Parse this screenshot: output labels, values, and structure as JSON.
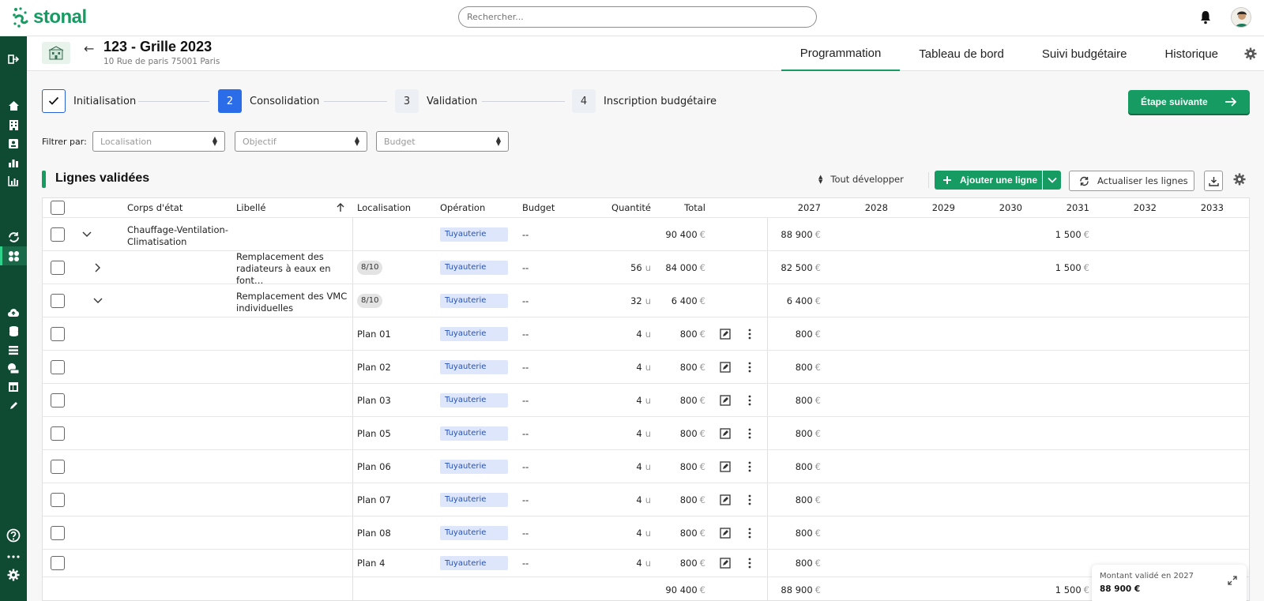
{
  "brand": {
    "name": "stonal",
    "color": "#169b62"
  },
  "search": {
    "placeholder": "Rechercher..."
  },
  "header": {
    "title": "123 - Grille 2023",
    "address": "10 Rue de paris 75001 Paris",
    "tabs": [
      {
        "label": "Programmation",
        "active": true
      },
      {
        "label": "Tableau de bord",
        "active": false
      },
      {
        "label": "Suivi budgétaire",
        "active": false
      },
      {
        "label": "Historique",
        "active": false
      }
    ]
  },
  "stepper": {
    "steps": [
      {
        "num": "",
        "label": "Initialisation",
        "state": "done"
      },
      {
        "num": "2",
        "label": "Consolidation",
        "state": "current"
      },
      {
        "num": "3",
        "label": "Validation",
        "state": "todo"
      },
      {
        "num": "4",
        "label": "Inscription budgétaire",
        "state": "todo"
      }
    ],
    "next_label": "Étape suivante"
  },
  "filters": {
    "label": "Filtrer par:",
    "selects": [
      {
        "placeholder": "Localisation"
      },
      {
        "placeholder": "Objectif"
      },
      {
        "placeholder": "Budget"
      }
    ]
  },
  "section": {
    "title": "Lignes validées",
    "expand_all": "Tout développer",
    "add_line": "Ajouter une ligne",
    "refresh": "Actualiser les lignes"
  },
  "table": {
    "headers": {
      "corps": "Corps d'état",
      "libelle": "Libellé",
      "localisation": "Localisation",
      "operation": "Opération",
      "budget": "Budget",
      "quantite": "Quantité",
      "total": "Total",
      "years": [
        "2027",
        "2028",
        "2029",
        "2030",
        "2031",
        "2032",
        "2033"
      ]
    },
    "currency": "€",
    "rows": [
      {
        "chev": "down",
        "chev_level": 1,
        "corps": "Chauffage-Ventilation-Climatisation",
        "libelle": "",
        "loc": "",
        "op": "Tuyauterie",
        "budget": "--",
        "qty": "",
        "unit": "",
        "total": "90 400",
        "y2027": "88 900",
        "y2031": "1 500",
        "actions": false
      },
      {
        "chev": "right",
        "chev_level": 2,
        "corps": "",
        "libelle": "Remplacement des radiateurs à eaux en font…",
        "loc": "",
        "pill": "8/10",
        "op": "Tuyauterie",
        "budget": "--",
        "qty": "56",
        "unit": "u",
        "total": "84 000",
        "y2027": "82 500",
        "y2031": "1 500",
        "actions": false
      },
      {
        "chev": "down",
        "chev_level": 2,
        "corps": "",
        "libelle": "Remplacement des VMC individuelles",
        "loc": "",
        "pill": "8/10",
        "op": "Tuyauterie",
        "budget": "--",
        "qty": "32",
        "unit": "u",
        "total": "6 400",
        "y2027": "6 400",
        "y2031": "",
        "actions": false
      },
      {
        "chev": "",
        "corps": "",
        "libelle": "",
        "loc": "Plan 01",
        "op": "Tuyauterie",
        "budget": "--",
        "qty": "4",
        "unit": "u",
        "total": "800",
        "y2027": "800",
        "y2031": "",
        "actions": true
      },
      {
        "chev": "",
        "corps": "",
        "libelle": "",
        "loc": "Plan 02",
        "op": "Tuyauterie",
        "budget": "--",
        "qty": "4",
        "unit": "u",
        "total": "800",
        "y2027": "800",
        "y2031": "",
        "actions": true
      },
      {
        "chev": "",
        "corps": "",
        "libelle": "",
        "loc": "Plan 03",
        "op": "Tuyauterie",
        "budget": "--",
        "qty": "4",
        "unit": "u",
        "total": "800",
        "y2027": "800",
        "y2031": "",
        "actions": true
      },
      {
        "chev": "",
        "corps": "",
        "libelle": "",
        "loc": "Plan 05",
        "op": "Tuyauterie",
        "budget": "--",
        "qty": "4",
        "unit": "u",
        "total": "800",
        "y2027": "800",
        "y2031": "",
        "actions": true
      },
      {
        "chev": "",
        "corps": "",
        "libelle": "",
        "loc": "Plan 06",
        "op": "Tuyauterie",
        "budget": "--",
        "qty": "4",
        "unit": "u",
        "total": "800",
        "y2027": "800",
        "y2031": "",
        "actions": true
      },
      {
        "chev": "",
        "corps": "",
        "libelle": "",
        "loc": "Plan 07",
        "op": "Tuyauterie",
        "budget": "--",
        "qty": "4",
        "unit": "u",
        "total": "800",
        "y2027": "800",
        "y2031": "",
        "actions": true
      },
      {
        "chev": "",
        "corps": "",
        "libelle": "",
        "loc": "Plan 08",
        "op": "Tuyauterie",
        "budget": "--",
        "qty": "4",
        "unit": "u",
        "total": "800",
        "y2027": "800",
        "y2031": "",
        "actions": true
      },
      {
        "chev": "",
        "corps": "",
        "libelle": "",
        "loc": "Plan 4",
        "op": "Tuyauterie",
        "budget": "--",
        "qty": "4",
        "unit": "u",
        "total": "800",
        "y2027": "800",
        "y2031": "",
        "actions": true
      }
    ],
    "footer": {
      "total": "90 400",
      "y2027": "88 900",
      "y2031": "1 500"
    }
  },
  "summary_card": {
    "label": "Montant validé en 2027",
    "value": "88 900 €"
  }
}
